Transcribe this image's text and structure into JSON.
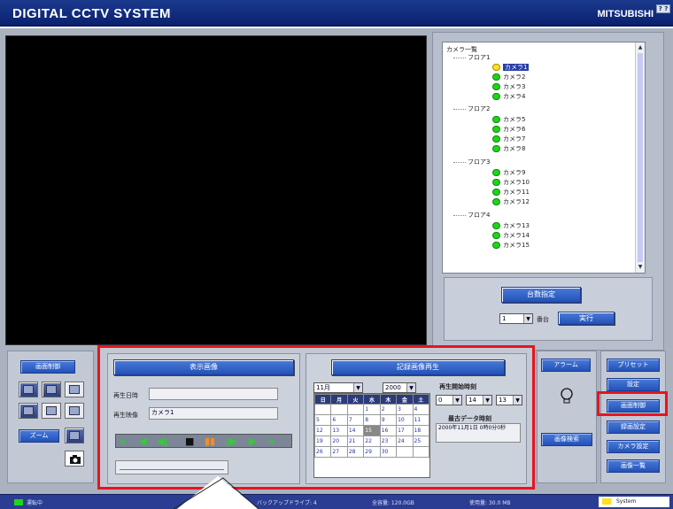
{
  "title": "DIGITAL CCTV SYSTEM",
  "brand": "MITSUBISHI",
  "corner": "? ?",
  "camera_list": {
    "header": "カメラ一覧",
    "floors": [
      {
        "name": "フロア1",
        "cameras": [
          "カメラ1",
          "カメラ2",
          "カメラ3",
          "カメラ4"
        ]
      },
      {
        "name": "フロア2",
        "cameras": [
          "カメラ5",
          "カメラ6",
          "カメラ7",
          "カメラ8"
        ]
      },
      {
        "name": "フロア3",
        "cameras": [
          "カメラ9",
          "カメラ10",
          "カメラ11",
          "カメラ12"
        ]
      },
      {
        "name": "フロア4",
        "cameras": [
          "カメラ13",
          "カメラ14",
          "カメラ15"
        ]
      }
    ],
    "selected": "カメラ1",
    "count_button": "台数指定",
    "count_value": "1",
    "count_unit": "番台",
    "run_button": "実行"
  },
  "left_ctrl": {
    "button": "画面制御",
    "button2": "ズーム"
  },
  "display": {
    "header": "表示画像",
    "date_label": "再生日時",
    "date_value": "",
    "camera_label": "再生映像",
    "camera_value": "カメラ1"
  },
  "recorded": {
    "header": "記録画像再生",
    "month": "11月",
    "year": "2000",
    "start_label": "再生開始時刻",
    "hour": "0",
    "minute": "14",
    "second": "13",
    "latest_label": "最古データ時刻",
    "latest_value": "2000年11月1日 0時0分0秒",
    "weekdays": [
      "日",
      "月",
      "火",
      "水",
      "木",
      "金",
      "土"
    ],
    "days": [
      [
        "",
        "",
        "",
        "1",
        "2",
        "3",
        "4"
      ],
      [
        "5",
        "6",
        "7",
        "8",
        "9",
        "10",
        "11"
      ],
      [
        "12",
        "13",
        "14",
        "15",
        "16",
        "17",
        "18"
      ],
      [
        "19",
        "20",
        "21",
        "22",
        "23",
        "24",
        "25"
      ],
      [
        "26",
        "27",
        "28",
        "29",
        "30",
        "",
        ""
      ]
    ],
    "selected_day": "15"
  },
  "right_mid": {
    "alarm": "アラーム",
    "search": "画像検索"
  },
  "right_buttons": [
    "プリセット",
    "設定",
    "画面制御",
    "録画設定",
    "カメラ設定",
    "画像一覧"
  ],
  "statusbar": {
    "left": "運転中",
    "backup": "バックアップドライブ: 4",
    "capacity": "全容量: 120.0GB",
    "used": "使用量: 30.0 MB",
    "right": "System"
  },
  "colors": {
    "title_bg": "#0b2170",
    "highlight": "#e8141e",
    "camera_ok": "#22d21c",
    "camera_selected": "#ffe21a"
  }
}
